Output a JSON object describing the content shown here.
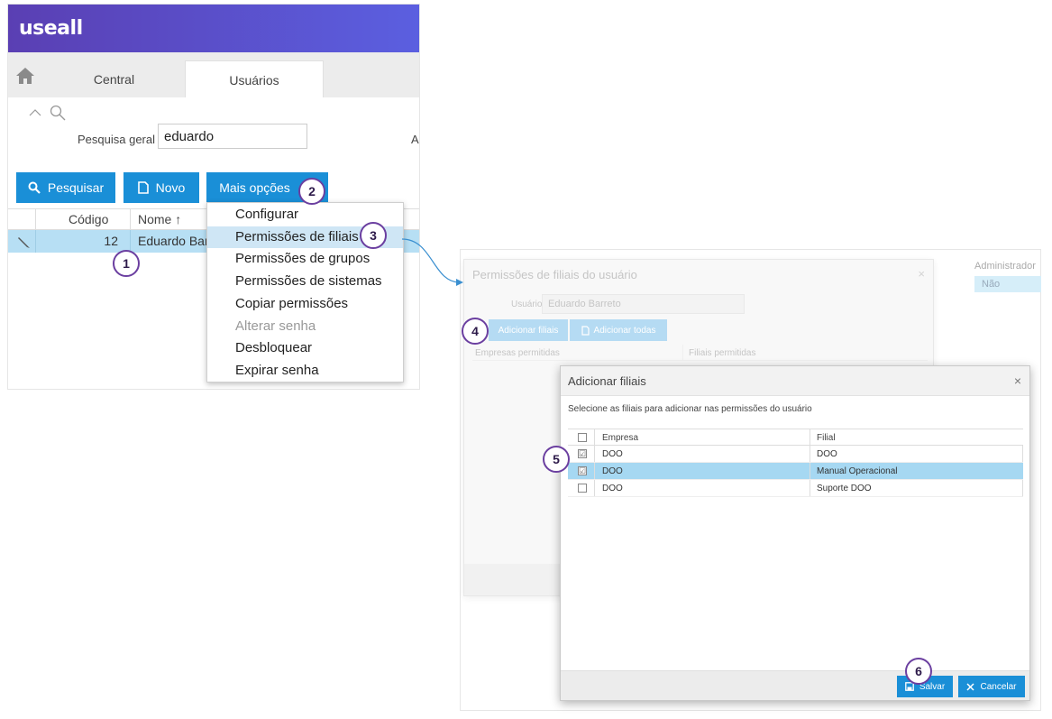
{
  "app": {
    "logo": "useall",
    "tabs": {
      "central": "Central",
      "usuarios": "Usuários"
    },
    "search": {
      "label": "Pesquisa geral",
      "value": "eduardo",
      "cut_label": "A"
    },
    "buttons": {
      "pesquisar": "Pesquisar",
      "novo": "Novo",
      "mais_opcoes": "Mais opções"
    },
    "grid": {
      "headers": {
        "codigo": "Código",
        "nome": "Nome ↑"
      },
      "row": {
        "codigo": "12",
        "nome": "Eduardo Bar"
      }
    },
    "dropdown": [
      {
        "label": "Configurar"
      },
      {
        "label": "Permissões de filiais"
      },
      {
        "label": "Permissões de grupos"
      },
      {
        "label": "Permissões de sistemas"
      },
      {
        "label": "Copiar permissões"
      },
      {
        "label": "Alterar senha"
      },
      {
        "label": "Desbloquear"
      },
      {
        "label": "Expirar senha"
      }
    ]
  },
  "callouts": {
    "c1": "1",
    "c2": "2",
    "c3": "3",
    "c4": "4",
    "c5": "5",
    "c6": "6"
  },
  "background": {
    "col_header": "Administrador",
    "row_value": "Não"
  },
  "perm_dialog": {
    "title": "Permissões de filiais do usuário",
    "close": "×",
    "user_label": "Usuário",
    "user_value": "Eduardo Barreto",
    "btn_add": "Adicionar filiais",
    "btn_all": "Adicionar todas",
    "col_empresas": "Empresas permitidas",
    "col_filiais": "Filiais permitidas"
  },
  "add_dialog": {
    "title": "Adicionar filiais",
    "close": "×",
    "description": "Selecione as filiais para adicionar nas permissões do usuário",
    "headers": {
      "empresa": "Empresa",
      "filial": "Filial"
    },
    "rows": [
      {
        "empresa": "DOO",
        "filial": "DOO",
        "checked": "☑"
      },
      {
        "empresa": "DOO",
        "filial": "Manual Operacional",
        "checked": "☑"
      },
      {
        "empresa": "DOO",
        "filial": "Suporte DOO",
        "checked": ""
      }
    ],
    "btn_salvar": "Salvar",
    "btn_cancelar": "Cancelar"
  },
  "colors": {
    "brand_start": "#5a3fb3",
    "brand_end": "#5b5fe0",
    "primary": "#1a8fd7",
    "row_selected": "#b7dff4",
    "callout_border": "#6b3fa0"
  }
}
